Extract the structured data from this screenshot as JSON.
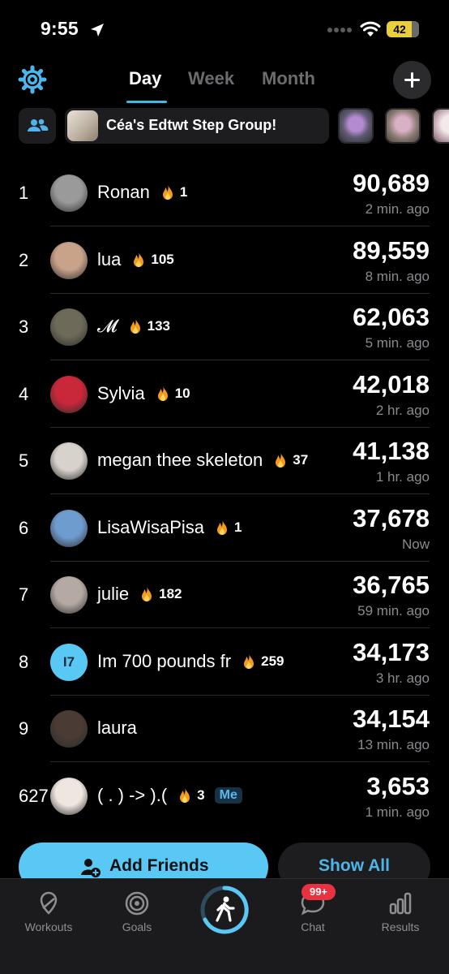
{
  "status_bar": {
    "time": "9:55",
    "battery": "42"
  },
  "header": {
    "tabs": [
      {
        "label": "Day",
        "active": true
      },
      {
        "label": "Week",
        "active": false
      },
      {
        "label": "Month",
        "active": false
      }
    ]
  },
  "group": {
    "name": "Céa's Edtwt Step Group!"
  },
  "leaderboard": [
    {
      "rank": "1",
      "name": "Ronan",
      "streak": "1",
      "steps": "90,689",
      "ago": "2 min. ago",
      "avatar_color": "#9a9a9a"
    },
    {
      "rank": "2",
      "name": "lua",
      "streak": "105",
      "steps": "89,559",
      "ago": "8 min. ago",
      "avatar_color": "#c9a28a"
    },
    {
      "rank": "3",
      "name": "𝓜",
      "streak": "133",
      "steps": "62,063",
      "ago": "5 min. ago",
      "avatar_color": "#6e6a5a"
    },
    {
      "rank": "4",
      "name": "Sylvia",
      "streak": "10",
      "steps": "42,018",
      "ago": "2 hr. ago",
      "avatar_color": "#c8283a"
    },
    {
      "rank": "5",
      "name": "megan thee skeleton",
      "streak": "37",
      "steps": "41,138",
      "ago": "1 hr. ago",
      "avatar_color": "#d8d2cc"
    },
    {
      "rank": "6",
      "name": "LisaWisaPisa",
      "streak": "1",
      "steps": "37,678",
      "ago": "Now",
      "avatar_color": "#6f9ccf"
    },
    {
      "rank": "7",
      "name": "julie",
      "streak": "182",
      "steps": "36,765",
      "ago": "59 min. ago",
      "avatar_color": "#b5a9a3"
    },
    {
      "rank": "8",
      "name": "Im 700 pounds fr",
      "streak": "259",
      "steps": "34,173",
      "ago": "3 hr. ago",
      "avatar_color": "#5ac8f5",
      "initials": "I7"
    },
    {
      "rank": "9",
      "name": "laura",
      "streak": "",
      "steps": "34,154",
      "ago": "13 min. ago",
      "avatar_color": "#4a3b35"
    },
    {
      "rank": "627",
      "name": "( . ) -> ).(",
      "streak": "3",
      "steps": "3,653",
      "ago": "1 min. ago",
      "avatar_color": "#efe6e0",
      "me_label": "Me"
    }
  ],
  "actions": {
    "add_friends": "Add Friends",
    "show_all": "Show All"
  },
  "tabbar": {
    "items": [
      {
        "label": "Workouts",
        "icon": "map-pin-icon"
      },
      {
        "label": "Goals",
        "icon": "target-icon"
      },
      {
        "label": "",
        "icon": "walking-icon"
      },
      {
        "label": "Chat",
        "icon": "chat-bubble-icon",
        "badge": "99+"
      },
      {
        "label": "Results",
        "icon": "bar-chart-icon"
      }
    ]
  },
  "colors": {
    "accent": "#5ac8f5",
    "flame": "#f29b1e",
    "badge": "#e8323f"
  }
}
